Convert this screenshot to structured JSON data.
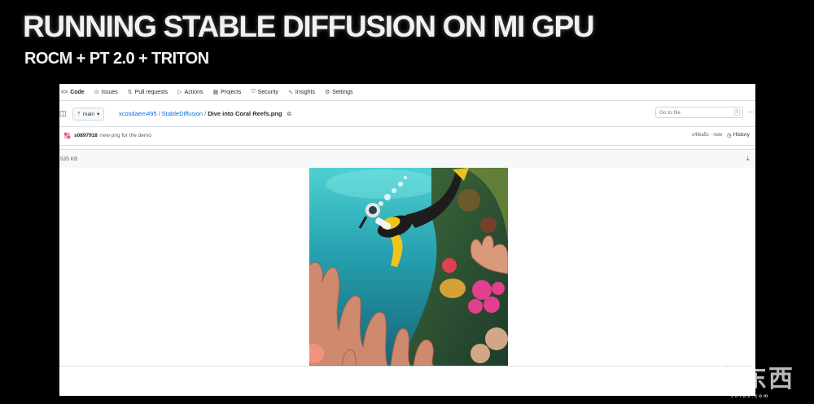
{
  "slide": {
    "title": "RUNNING STABLE DIFFUSION ON MI GPU",
    "subtitle": "ROCM + PT 2.0 + TRITON"
  },
  "repo_tabs": [
    {
      "label": "Code",
      "icon": "code-icon"
    },
    {
      "label": "Issues",
      "icon": "issue-icon"
    },
    {
      "label": "Pull requests",
      "icon": "pull-request-icon"
    },
    {
      "label": "Actions",
      "icon": "actions-icon"
    },
    {
      "label": "Projects",
      "icon": "projects-icon"
    },
    {
      "label": "Security",
      "icon": "shield-icon"
    },
    {
      "label": "Insights",
      "icon": "graph-icon"
    },
    {
      "label": "Settings",
      "icon": "gear-icon"
    }
  ],
  "file_bar": {
    "branch": "main",
    "owner": "xcosdaem495",
    "repo": "StableDiffusion",
    "file": "Dive into Coral Reefs.png",
    "goto_placeholder": "Go to file",
    "goto_key": "t"
  },
  "commit": {
    "author": "s0897918",
    "message": "new png for the demo",
    "meta": "c4fea5c · now",
    "history_label": "History"
  },
  "file_info": {
    "size": "535 KB"
  },
  "image": {
    "alt": "Dive into Coral Reefs.png"
  },
  "watermark": {
    "text": "智东西",
    "sub": "zhidx.com"
  }
}
